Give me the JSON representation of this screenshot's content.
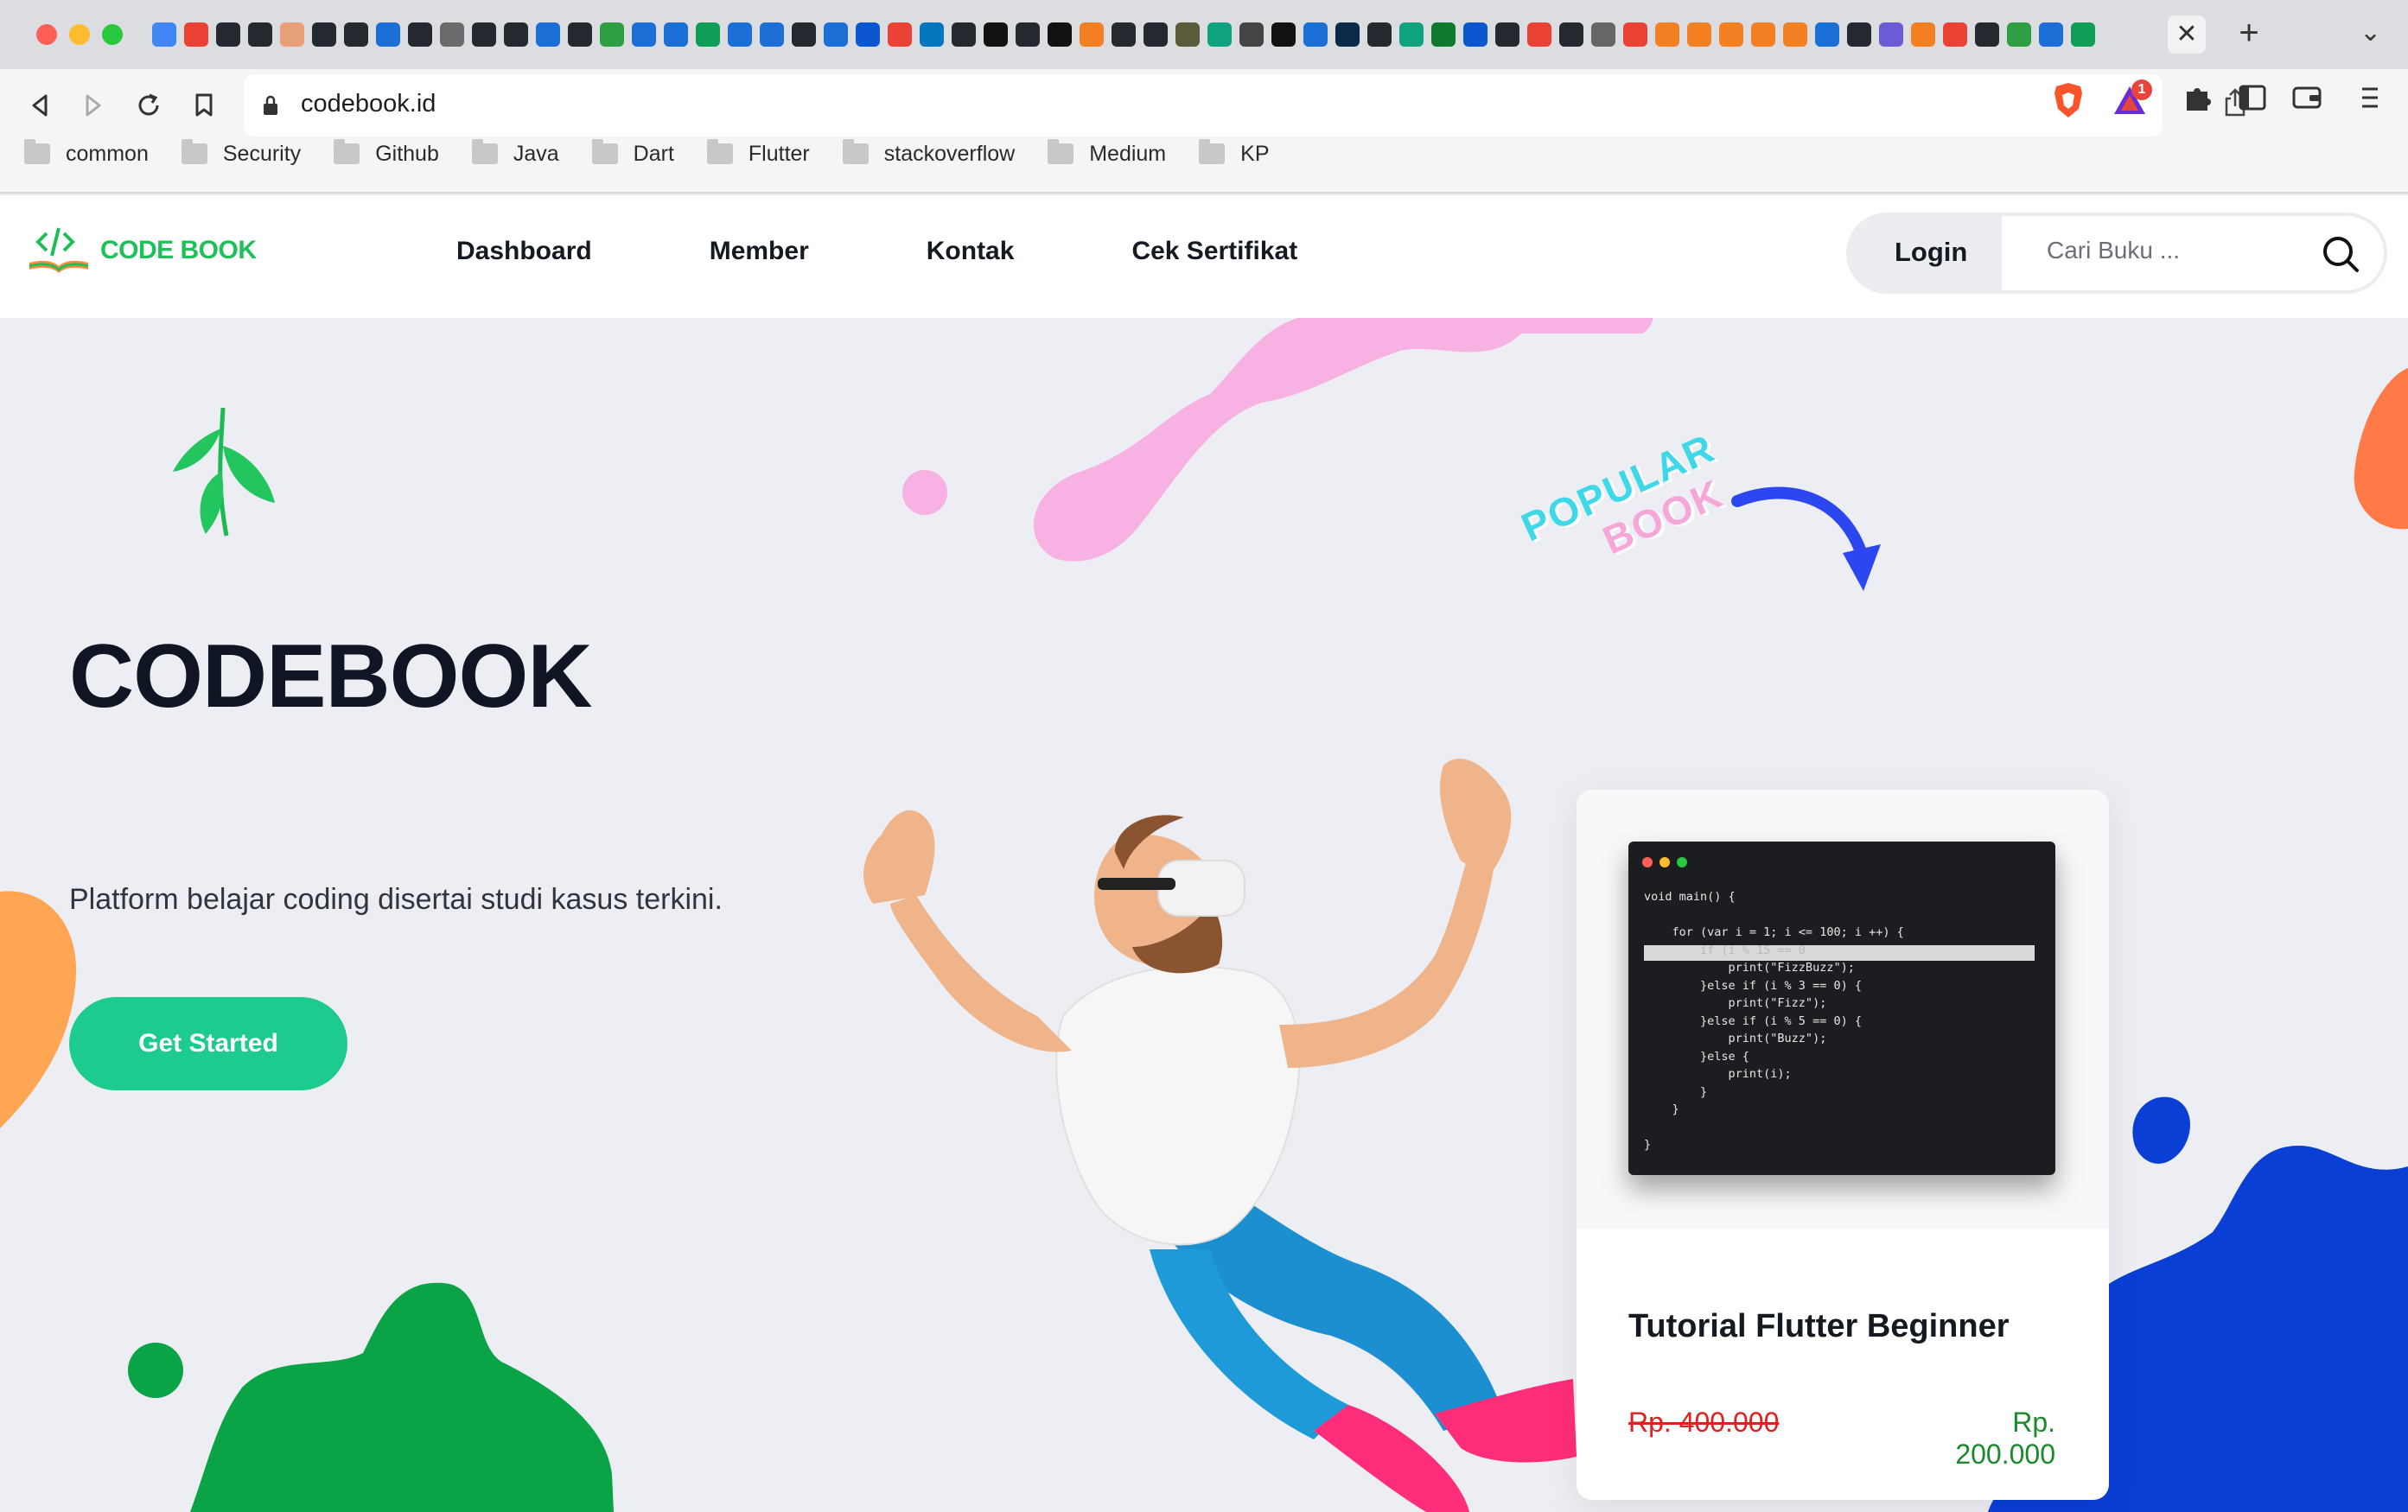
{
  "browser": {
    "tab_close_icon": "close-icon",
    "new_tab_label": "+",
    "tab_menu_label": "⌄",
    "url": "codebook.id",
    "notification_count": "1",
    "favicon_count": 62,
    "bookmarks": [
      {
        "label": "common"
      },
      {
        "label": "Security"
      },
      {
        "label": "Github"
      },
      {
        "label": "Java"
      },
      {
        "label": "Dart"
      },
      {
        "label": "Flutter"
      },
      {
        "label": "stackoverflow"
      },
      {
        "label": "Medium"
      },
      {
        "label": "KP"
      }
    ]
  },
  "site": {
    "logo_text": "CODE BOOK",
    "nav": [
      {
        "label": "Dashboard"
      },
      {
        "label": "Member"
      },
      {
        "label": "Kontak"
      },
      {
        "label": "Cek Sertifikat"
      }
    ],
    "login_label": "Login",
    "search_placeholder": "Cari Buku ..."
  },
  "hero": {
    "title": "CODEBOOK",
    "subtitle": "Platform belajar coding disertai studi kasus terkini.",
    "cta_label": "Get Started"
  },
  "popular": {
    "line1": "POPULAR",
    "line2": "BOOK"
  },
  "card": {
    "title": "Tutorial Flutter Beginner",
    "price_old": "Rp. 400.000",
    "price_new": "Rp. 200.000",
    "code": [
      "void main() {",
      "",
      "    for (var i = 1; i <= 100; i ++) {",
      "        if (i % 15 == 0",
      "            print(\"FizzBuzz\");",
      "        }else if (i % 3 == 0) {",
      "            print(\"Fizz\");",
      "        }else if (i % 5 == 0) {",
      "            print(\"Buzz\");",
      "        }else {",
      "            print(i);",
      "        }",
      "    }",
      "",
      "}"
    ]
  },
  "colors": {
    "accent_green": "#1ecb8e",
    "logo_green": "#1fbf5a",
    "pink_blob": "#f7b1e3",
    "blue_blob": "#0a3fd6",
    "price_old": "#e02020",
    "price_new": "#1a8a2a"
  }
}
